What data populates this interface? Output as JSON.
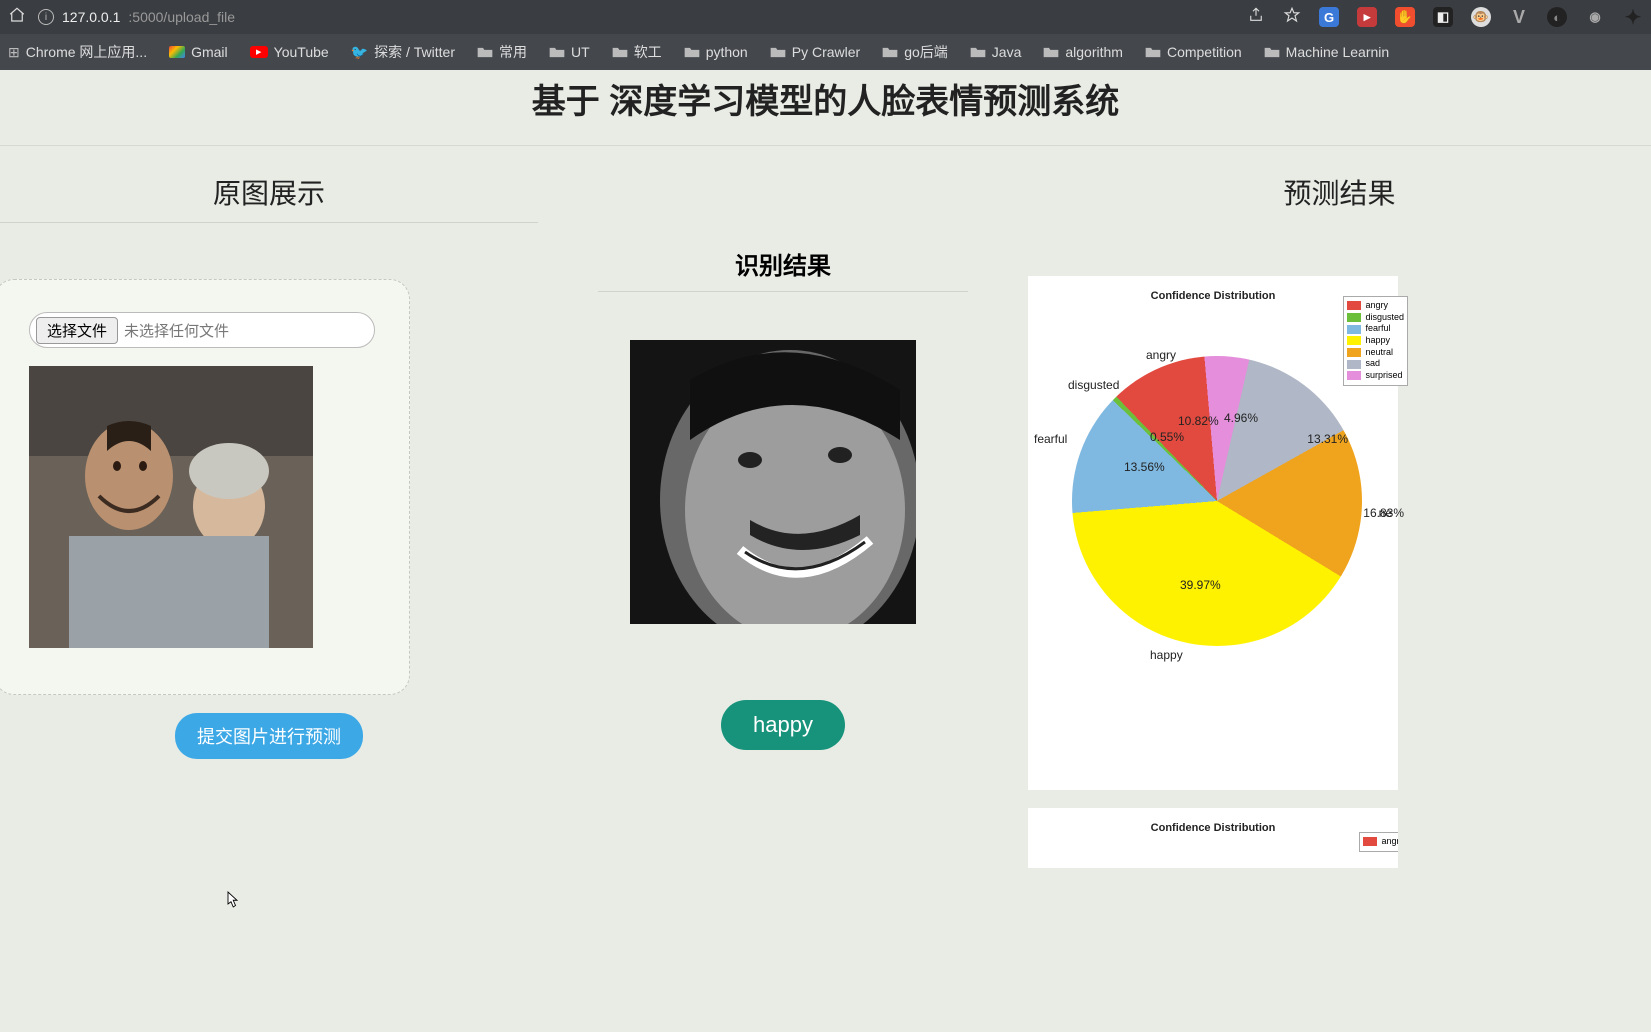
{
  "browser": {
    "url_host": "127.0.0.1",
    "url_port_path": ":5000/upload_file"
  },
  "bookmarks": [
    "Chrome 网上应用...",
    "Gmail",
    "YouTube",
    "探索 / Twitter",
    "常用",
    "UT",
    "软工",
    "python",
    "Py Crawler",
    "go后端",
    "Java",
    "algorithm",
    "Competition",
    "Machine Learnin"
  ],
  "page": {
    "title": "基于 深度学习模型的人脸表情预测系统",
    "left_col_title": "原图展示",
    "right_col_title": "预测结果",
    "upload": {
      "choose_label": "选择文件",
      "status": "未选择任何文件",
      "submit_label": "提交图片进行预测"
    },
    "mid": {
      "title": "识别结果",
      "pill": "happy"
    }
  },
  "chart_data": {
    "type": "pie",
    "title": "Confidence Distribution",
    "series": [
      {
        "name": "angry",
        "value": 10.82,
        "color": "#e24a3f"
      },
      {
        "name": "disgusted",
        "value": 0.55,
        "color": "#6bbf3b"
      },
      {
        "name": "fearful",
        "value": 13.56,
        "color": "#7fb8e0"
      },
      {
        "name": "happy",
        "value": 39.97,
        "color": "#fff200"
      },
      {
        "name": "neutral",
        "value": 16.83,
        "color": "#f0a41e"
      },
      {
        "name": "sad",
        "value": 13.31,
        "color": "#b0b7c6"
      },
      {
        "name": "surprised",
        "value": 4.96,
        "color": "#e58edb"
      }
    ],
    "labels": {
      "angry": "angry",
      "disgusted": "disgusted",
      "fearful": "fearful",
      "happy": "happy",
      "neutral": "ne",
      "sad": "",
      "surprised": "surprised"
    }
  },
  "chart_data_2": {
    "type": "pie",
    "title": "Confidence Distribution",
    "legend_visible": [
      "angry"
    ]
  },
  "colors": {
    "angry": "#e24a3f",
    "disgusted": "#6bbf3b",
    "fearful": "#7fb8e0",
    "happy": "#fff200",
    "neutral": "#f0a41e",
    "sad": "#b0b7c6",
    "surprised": "#e58edb"
  }
}
